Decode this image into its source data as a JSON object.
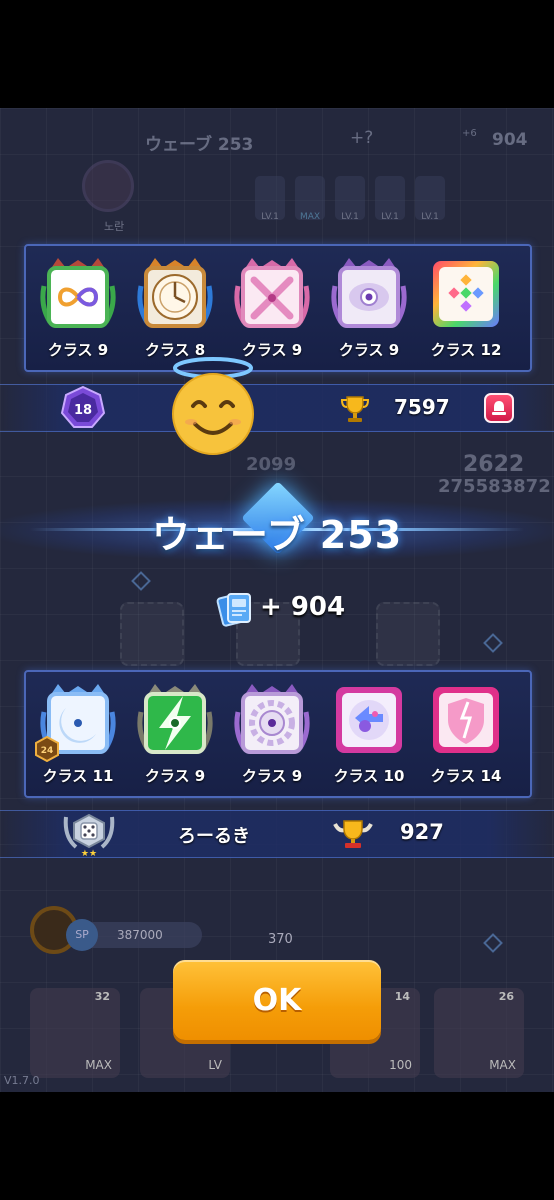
{
  "background": {
    "wave_label": "ウェーブ 253",
    "unknown_label": "+?",
    "card_count": "904",
    "card_plus": "+6",
    "player_name": "노란",
    "level_badges": [
      "LV.1",
      "MAX",
      "LV.1",
      "LV.1",
      "LV.1"
    ],
    "score_a": "2622",
    "score_b": "275583872",
    "score_c": "2099",
    "sp_label": "SP",
    "sp_value": "387000",
    "mid_value": "370",
    "bottom_cards": [
      {
        "top": "32",
        "bottom": "MAX"
      },
      {
        "top": "",
        "bottom": "LV"
      },
      {
        "top": "14",
        "bottom": "100"
      },
      {
        "top": "26",
        "bottom": "MAX"
      }
    ],
    "version": "V1.7.0"
  },
  "opponent": {
    "dice": [
      {
        "label": "クラス 9",
        "icon": "infinity-dice-icon",
        "color": "#3aa84a"
      },
      {
        "label": "クラス 8",
        "icon": "clock-dice-icon",
        "color": "#c98a3a"
      },
      {
        "label": "クラス 9",
        "icon": "cross-dice-icon",
        "color": "#d86aa8"
      },
      {
        "label": "クラス 9",
        "icon": "eye-dice-icon",
        "color": "#9b6ad0"
      },
      {
        "label": "クラス 12",
        "icon": "rainbow-dice-icon",
        "color": "#e84a6a"
      }
    ],
    "rank": "18",
    "trophies": "7597"
  },
  "result": {
    "wave_title": "ウェーブ 253",
    "reward": "+ 904"
  },
  "player": {
    "dice": [
      {
        "label": "クラス 11",
        "icon": "moon-dice-icon",
        "color": "#4a86e0",
        "badge": "24"
      },
      {
        "label": "クラス 9",
        "icon": "lightning-dice-icon",
        "color": "#2fb84a"
      },
      {
        "label": "クラス 9",
        "icon": "gear-dice-icon",
        "color": "#9b6ad0"
      },
      {
        "label": "クラス 10",
        "icon": "swap-dice-icon",
        "color": "#d43aa0"
      },
      {
        "label": "クラス 14",
        "icon": "shield-dice-icon",
        "color": "#e0308a"
      }
    ],
    "name": "ろーるき",
    "score": "927"
  },
  "ok_label": "OK",
  "colors": {
    "panel_border": "#4b67b8",
    "ok_button": "#f59d08",
    "alert": "#d21a49"
  }
}
